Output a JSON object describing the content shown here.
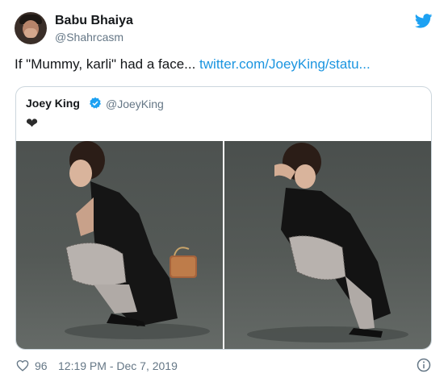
{
  "tweet": {
    "author_name": "Babu Bhaiya",
    "author_handle": "@Shahrcasm",
    "text_prefix": "If \"Mummy, karli\" had a face... ",
    "text_link": "twitter.com/JoeyKing/statu...",
    "likes": "96",
    "timestamp": "12:19 PM - Dec 7, 2019"
  },
  "quoted": {
    "author_name": "Joey King",
    "author_handle": "@JoeyKing",
    "text": "❤"
  },
  "icons": {
    "brand": "twitter-bird-icon",
    "verified": "verified-badge-icon",
    "like": "heart-icon",
    "info": "info-icon"
  },
  "colors": {
    "link": "#1b95e0",
    "secondary_text": "#657786",
    "border": "#ccd6dd",
    "brand": "#1da1f2"
  }
}
